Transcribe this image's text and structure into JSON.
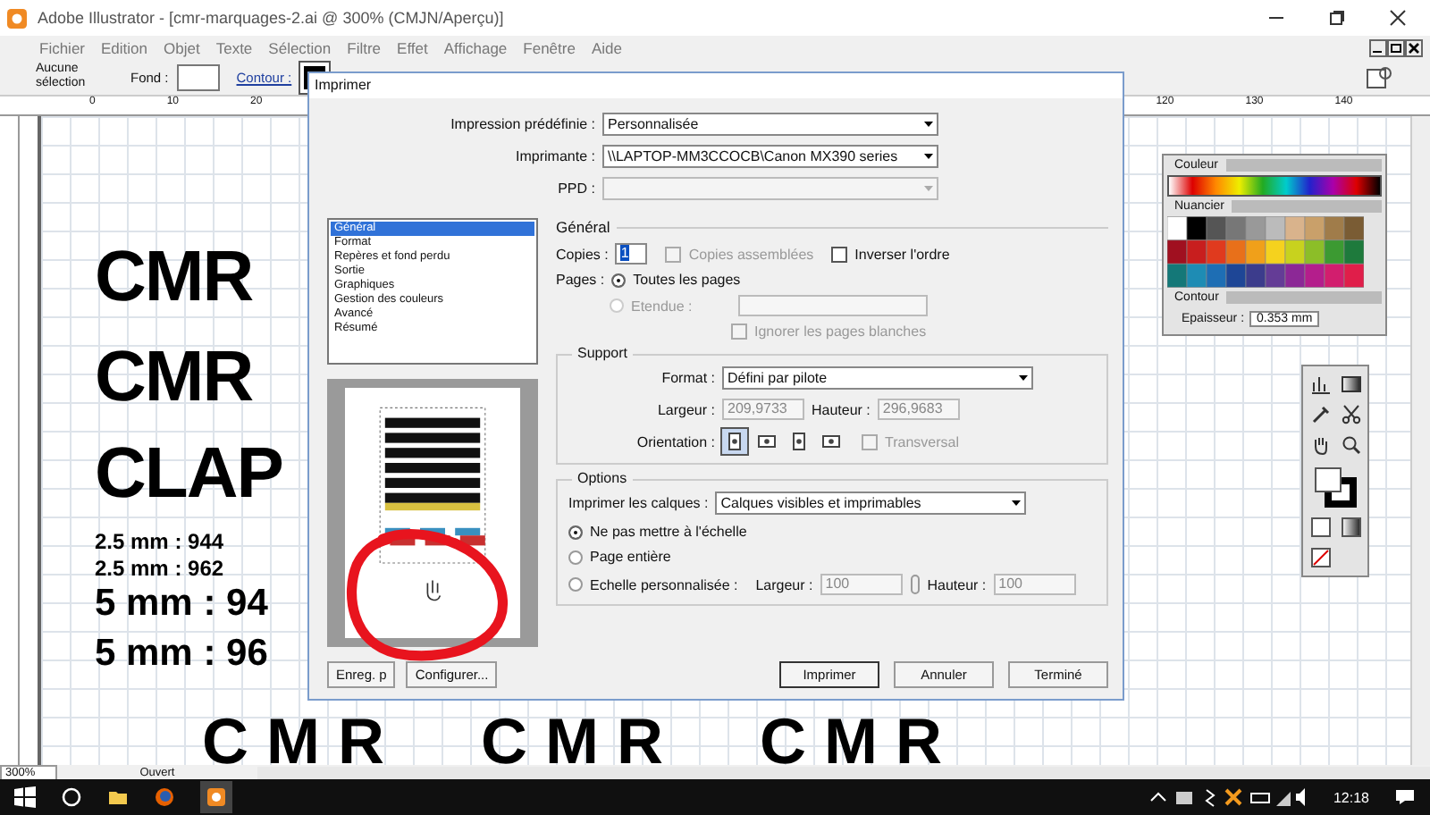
{
  "window": {
    "title": "Adobe Illustrator - [cmr-marquages-2.ai @ 300% (CMJN/Aperçu)]"
  },
  "menu": [
    "Fichier",
    "Edition",
    "Objet",
    "Texte",
    "Sélection",
    "Filtre",
    "Effet",
    "Affichage",
    "Fenêtre",
    "Aide"
  ],
  "control_bar": {
    "selection": "Aucune sélection",
    "fill_label": "Fond :",
    "stroke_label": "Contour :"
  },
  "ruler": {
    "ticks": [
      {
        "label": "0",
        "kind": "left"
      },
      {
        "label": "10",
        "kind": "left"
      },
      {
        "label": "20",
        "kind": "left"
      },
      {
        "label": "120",
        "kind": "right"
      },
      {
        "label": "130",
        "kind": "right"
      },
      {
        "label": "140",
        "kind": "right"
      }
    ]
  },
  "canvas": {
    "texts": [
      {
        "text": "CMR",
        "kind": "big"
      },
      {
        "text": "CMR",
        "kind": "big"
      },
      {
        "text": "CLAP",
        "kind": "big"
      },
      {
        "text": "2.5 mm : 944",
        "kind": "small"
      },
      {
        "text": "2.5 mm : 962",
        "kind": "small"
      },
      {
        "text": "5 mm : 94",
        "kind": "medium"
      },
      {
        "text": "5 mm : 96",
        "kind": "medium"
      }
    ],
    "bottom_text": "CMR CMR CMR"
  },
  "status_bar": {
    "zoom": "300%",
    "status": "Ouvert"
  },
  "dialog": {
    "title": "Imprimer",
    "fields": [
      {
        "label": "Impression prédéfinie :",
        "value": "Personnalisée",
        "disabled": false
      },
      {
        "label": "Imprimante :",
        "value": "\\\\LAPTOP-MM3CCOCB\\Canon MX390 series",
        "disabled": false
      },
      {
        "label": "PPD :",
        "disabled": true
      }
    ],
    "categories": [
      {
        "label": "Général",
        "selected": true
      },
      {
        "label": "Format",
        "selected": false
      },
      {
        "label": "Repères et fond perdu",
        "selected": false
      },
      {
        "label": "Sortie",
        "selected": false
      },
      {
        "label": "Graphiques",
        "selected": false
      },
      {
        "label": "Gestion des couleurs",
        "selected": false
      },
      {
        "label": "Avancé",
        "selected": false
      },
      {
        "label": "Résumé",
        "selected": false
      }
    ],
    "section_title": "Général",
    "copies": {
      "label": "Copies :",
      "value": "1"
    },
    "collate": {
      "label": "Copies assemblées",
      "checked": false,
      "disabled": true
    },
    "reverse": {
      "label": "Inverser l'ordre",
      "checked": false
    },
    "pages_label": "Pages :",
    "pages": [
      {
        "label": "Toutes les pages",
        "selected": true,
        "disabled": false
      },
      {
        "label": "Etendue :",
        "selected": false,
        "disabled": true
      }
    ],
    "ignore_blank": {
      "label": "Ignorer les pages blanches",
      "checked": false,
      "disabled": true
    },
    "support": {
      "title": "Support",
      "format_label": "Format :",
      "format_value": "Défini par pilote",
      "width_label": "Largeur :",
      "width_value": "209,9733",
      "height_label": "Hauteur :",
      "height_value": "296,9683",
      "orientation_label": "Orientation :",
      "orientations": [
        {
          "selected": true
        },
        {
          "selected": false
        },
        {
          "selected": false
        },
        {
          "selected": false
        }
      ],
      "transverse": {
        "label": "Transversal",
        "checked": false,
        "disabled": true
      }
    },
    "options": {
      "title": "Options",
      "layers_label": "Imprimer les calques :",
      "layers_value": "Calques visibles et imprimables",
      "scales": [
        {
          "label": "Ne pas mettre à l'échelle",
          "selected": true
        },
        {
          "label": "Page entière",
          "selected": false
        },
        {
          "label": "Echelle personnalisée :",
          "selected": false
        }
      ],
      "width_label": "Largeur :",
      "width_value": "100",
      "height_label": "Hauteur :",
      "height_value": "100"
    },
    "left_buttons": [
      "Enreg. p",
      "Configurer..."
    ],
    "buttons": [
      {
        "label": "Imprimer",
        "kind": "default"
      },
      {
        "label": "Annuler",
        "kind": "plain"
      },
      {
        "label": "Terminé",
        "kind": "plain"
      }
    ]
  },
  "panels": {
    "color_tab": "Couleur",
    "swatch_tab": "Nuancier",
    "stroke_tab": "Contour",
    "weight_label": "Epaisseur :",
    "weight_value": "0.353 mm"
  },
  "taskbar": {
    "time": "12:18"
  }
}
